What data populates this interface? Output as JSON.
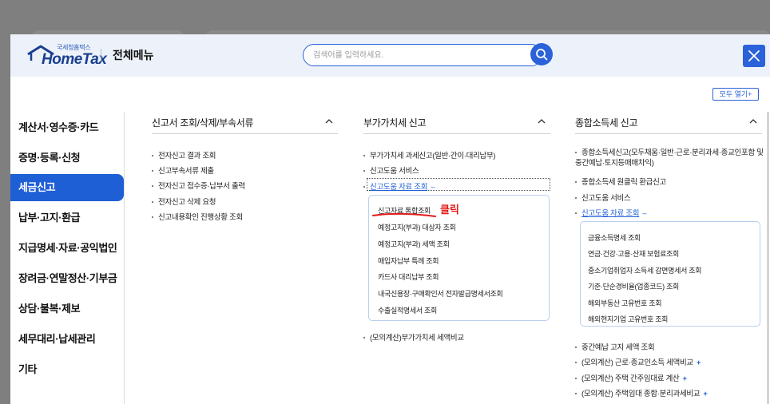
{
  "header": {
    "logo_small": "국세청홈택스",
    "logo_text": "HomeTax",
    "title": "전체메뉴",
    "search_placeholder": "검색어를 입력하세요."
  },
  "expand_all_label": "모두 열기+",
  "sidebar": {
    "items": [
      {
        "label": "계산서·영수증·카드"
      },
      {
        "label": "증명·등록·신청"
      },
      {
        "label": "세금신고"
      },
      {
        "label": "납부·고지·환급"
      },
      {
        "label": "지급명세·자료·공익법인"
      },
      {
        "label": "장려금·연말정산·기부금"
      },
      {
        "label": "상담·불복·제보"
      },
      {
        "label": "세무대리·납세관리"
      },
      {
        "label": "기타"
      }
    ],
    "active_index": 2
  },
  "col1": {
    "title": "신고서 조회/삭제/부속서류",
    "items": [
      "전자신고 결과 조회",
      "신고부속서류 제출",
      "전자신고 접수증·납부서 출력",
      "전자신고 삭제 요청",
      "신고내용확인 진행상황 조회"
    ]
  },
  "col2": {
    "title": "부가가치세 신고",
    "items": [
      "부가가치세 과세신고(일반·간이·대리납부)",
      "신고도움 서비스"
    ],
    "expanded_label": "신고도움 자료 조회",
    "expanded_marker": "–",
    "sub_items": [
      "신고자료 통합조회",
      "예정고지(부과) 대상자 조회",
      "예정고지(부과) 세액 조회",
      "매입자납부 특례 조회",
      "카드사 대리납부 조회",
      "내국신용장·구매확인서 전자발급명세서조회",
      "수출실적명세서 조회"
    ],
    "after_items": [
      "(모의계산)부가가치세 세액비교"
    ]
  },
  "col3": {
    "title": "종합소득세 신고",
    "items": [
      "종합소득세신고(모두채움·일반·근로·분리과세·종교인포함 및 중간예납·토지등매매차익)",
      "종합소득세 원클릭 환급신고",
      "신고도움 서비스"
    ],
    "expanded_label": "신고도움 자료 조회",
    "expanded_marker": "–",
    "sub_items": [
      "금융소득명세 조회",
      "연금·건강·고용·산재 보험료조회",
      "중소기업취업자 소득세 감면명세서 조회",
      "기준·단순경비율(업종코드) 조회",
      "해외부동산 고유번호 조회",
      "해외현지기업 고유번호 조회"
    ],
    "after_items": [
      "중간예납 고지 세액 조회",
      "(모의계산) 근로·종교인소득 세액비교",
      "(모의계산) 주택 간주임대료 계산",
      "(모의계산) 주택임대 종합·분리과세비교"
    ],
    "plus_marker": "+"
  },
  "annotation": {
    "text": "클릭",
    "color": "#e21a1a"
  }
}
